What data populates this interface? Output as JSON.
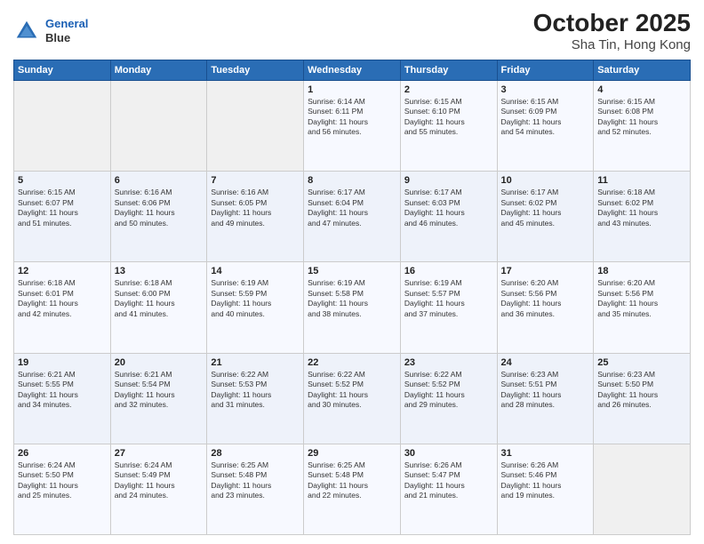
{
  "header": {
    "logo_line1": "General",
    "logo_line2": "Blue",
    "title": "October 2025",
    "subtitle": "Sha Tin, Hong Kong"
  },
  "weekdays": [
    "Sunday",
    "Monday",
    "Tuesday",
    "Wednesday",
    "Thursday",
    "Friday",
    "Saturday"
  ],
  "weeks": [
    [
      {
        "day": "",
        "info": ""
      },
      {
        "day": "",
        "info": ""
      },
      {
        "day": "",
        "info": ""
      },
      {
        "day": "1",
        "info": "Sunrise: 6:14 AM\nSunset: 6:11 PM\nDaylight: 11 hours\nand 56 minutes."
      },
      {
        "day": "2",
        "info": "Sunrise: 6:15 AM\nSunset: 6:10 PM\nDaylight: 11 hours\nand 55 minutes."
      },
      {
        "day": "3",
        "info": "Sunrise: 6:15 AM\nSunset: 6:09 PM\nDaylight: 11 hours\nand 54 minutes."
      },
      {
        "day": "4",
        "info": "Sunrise: 6:15 AM\nSunset: 6:08 PM\nDaylight: 11 hours\nand 52 minutes."
      }
    ],
    [
      {
        "day": "5",
        "info": "Sunrise: 6:15 AM\nSunset: 6:07 PM\nDaylight: 11 hours\nand 51 minutes."
      },
      {
        "day": "6",
        "info": "Sunrise: 6:16 AM\nSunset: 6:06 PM\nDaylight: 11 hours\nand 50 minutes."
      },
      {
        "day": "7",
        "info": "Sunrise: 6:16 AM\nSunset: 6:05 PM\nDaylight: 11 hours\nand 49 minutes."
      },
      {
        "day": "8",
        "info": "Sunrise: 6:17 AM\nSunset: 6:04 PM\nDaylight: 11 hours\nand 47 minutes."
      },
      {
        "day": "9",
        "info": "Sunrise: 6:17 AM\nSunset: 6:03 PM\nDaylight: 11 hours\nand 46 minutes."
      },
      {
        "day": "10",
        "info": "Sunrise: 6:17 AM\nSunset: 6:02 PM\nDaylight: 11 hours\nand 45 minutes."
      },
      {
        "day": "11",
        "info": "Sunrise: 6:18 AM\nSunset: 6:02 PM\nDaylight: 11 hours\nand 43 minutes."
      }
    ],
    [
      {
        "day": "12",
        "info": "Sunrise: 6:18 AM\nSunset: 6:01 PM\nDaylight: 11 hours\nand 42 minutes."
      },
      {
        "day": "13",
        "info": "Sunrise: 6:18 AM\nSunset: 6:00 PM\nDaylight: 11 hours\nand 41 minutes."
      },
      {
        "day": "14",
        "info": "Sunrise: 6:19 AM\nSunset: 5:59 PM\nDaylight: 11 hours\nand 40 minutes."
      },
      {
        "day": "15",
        "info": "Sunrise: 6:19 AM\nSunset: 5:58 PM\nDaylight: 11 hours\nand 38 minutes."
      },
      {
        "day": "16",
        "info": "Sunrise: 6:19 AM\nSunset: 5:57 PM\nDaylight: 11 hours\nand 37 minutes."
      },
      {
        "day": "17",
        "info": "Sunrise: 6:20 AM\nSunset: 5:56 PM\nDaylight: 11 hours\nand 36 minutes."
      },
      {
        "day": "18",
        "info": "Sunrise: 6:20 AM\nSunset: 5:56 PM\nDaylight: 11 hours\nand 35 minutes."
      }
    ],
    [
      {
        "day": "19",
        "info": "Sunrise: 6:21 AM\nSunset: 5:55 PM\nDaylight: 11 hours\nand 34 minutes."
      },
      {
        "day": "20",
        "info": "Sunrise: 6:21 AM\nSunset: 5:54 PM\nDaylight: 11 hours\nand 32 minutes."
      },
      {
        "day": "21",
        "info": "Sunrise: 6:22 AM\nSunset: 5:53 PM\nDaylight: 11 hours\nand 31 minutes."
      },
      {
        "day": "22",
        "info": "Sunrise: 6:22 AM\nSunset: 5:52 PM\nDaylight: 11 hours\nand 30 minutes."
      },
      {
        "day": "23",
        "info": "Sunrise: 6:22 AM\nSunset: 5:52 PM\nDaylight: 11 hours\nand 29 minutes."
      },
      {
        "day": "24",
        "info": "Sunrise: 6:23 AM\nSunset: 5:51 PM\nDaylight: 11 hours\nand 28 minutes."
      },
      {
        "day": "25",
        "info": "Sunrise: 6:23 AM\nSunset: 5:50 PM\nDaylight: 11 hours\nand 26 minutes."
      }
    ],
    [
      {
        "day": "26",
        "info": "Sunrise: 6:24 AM\nSunset: 5:50 PM\nDaylight: 11 hours\nand 25 minutes."
      },
      {
        "day": "27",
        "info": "Sunrise: 6:24 AM\nSunset: 5:49 PM\nDaylight: 11 hours\nand 24 minutes."
      },
      {
        "day": "28",
        "info": "Sunrise: 6:25 AM\nSunset: 5:48 PM\nDaylight: 11 hours\nand 23 minutes."
      },
      {
        "day": "29",
        "info": "Sunrise: 6:25 AM\nSunset: 5:48 PM\nDaylight: 11 hours\nand 22 minutes."
      },
      {
        "day": "30",
        "info": "Sunrise: 6:26 AM\nSunset: 5:47 PM\nDaylight: 11 hours\nand 21 minutes."
      },
      {
        "day": "31",
        "info": "Sunrise: 6:26 AM\nSunset: 5:46 PM\nDaylight: 11 hours\nand 19 minutes."
      },
      {
        "day": "",
        "info": ""
      }
    ]
  ]
}
